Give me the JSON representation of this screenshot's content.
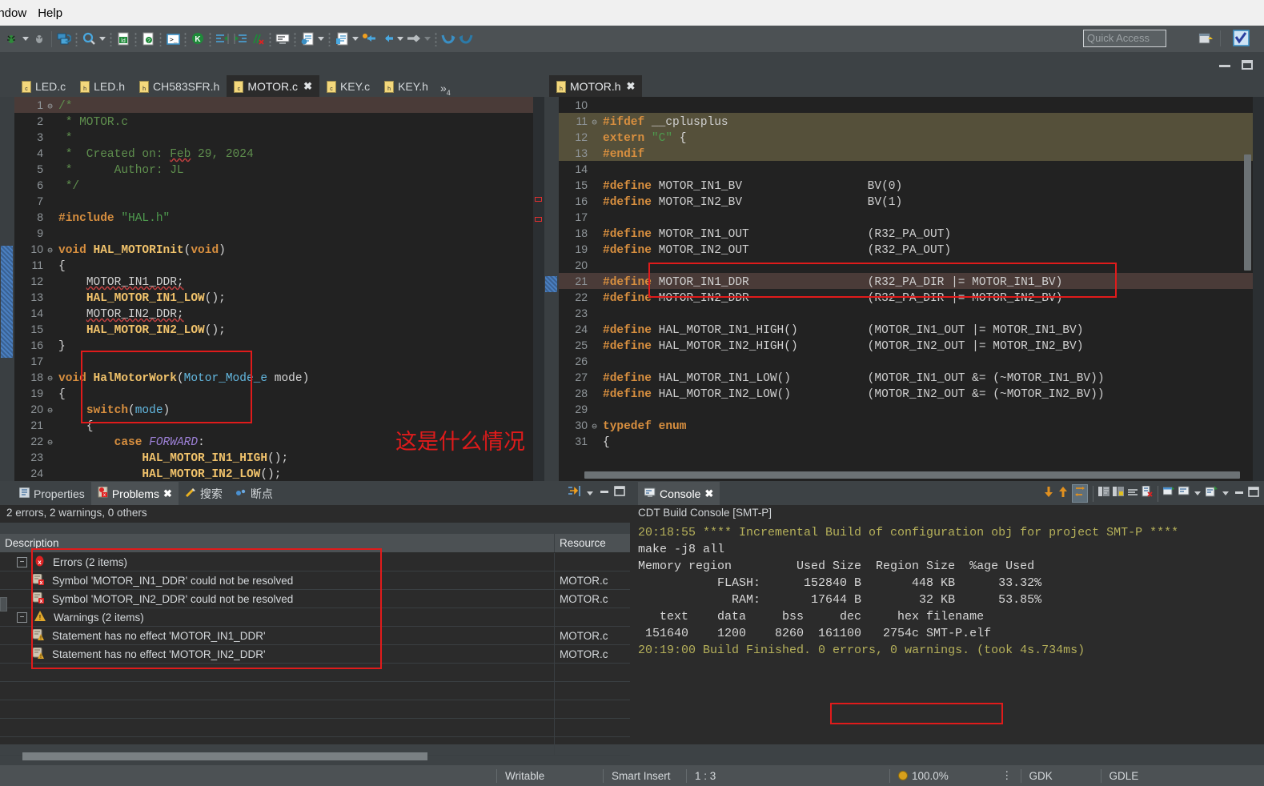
{
  "menubar": {
    "items": [
      "indow",
      "Help"
    ]
  },
  "toolbar": {
    "quick_access_placeholder": "Quick Access",
    "icons": [
      "bug-run-icon",
      "bug-run-dropdown",
      "debug-icon",
      "build-all-icon",
      "search-icon",
      "search-dropdown",
      "new-c-file-icon",
      "new-header-icon",
      "terminal-icon",
      "kconfig-icon",
      "indent-right-icon",
      "indent-left-icon",
      "comment-strike-icon",
      "console-icon",
      "open-type-icon",
      "open-type-dropdown",
      "open-resource-icon",
      "open-resource-dropdown",
      "back-annotate-icon",
      "back-arrow-icon",
      "back-dropdown",
      "forward-arrow-icon",
      "forward-dropdown",
      "undo-nav-icon",
      "redo-nav-icon"
    ],
    "right_icons": [
      "perspective-add-icon",
      "perspective-cpp-icon"
    ],
    "window_minimize": "minimize",
    "window_maximize": "maximize"
  },
  "editor_left": {
    "tabs": [
      {
        "label": "LED.c",
        "kind": "c",
        "active": false,
        "closable": false
      },
      {
        "label": "LED.h",
        "kind": "h",
        "active": false,
        "closable": false
      },
      {
        "label": "CH583SFR.h",
        "kind": "h",
        "active": false,
        "closable": false
      },
      {
        "label": "MOTOR.c",
        "kind": "c",
        "active": true,
        "closable": true
      },
      {
        "label": "KEY.c",
        "kind": "c",
        "active": false,
        "closable": false
      },
      {
        "label": "KEY.h",
        "kind": "h",
        "active": false,
        "closable": false
      }
    ],
    "overflow_label": "»",
    "overflow_count": "4",
    "lines": [
      {
        "n": "1",
        "fold": "⊖",
        "hl": "brown",
        "tokens": [
          {
            "t": "/*",
            "c": "cmt"
          }
        ]
      },
      {
        "n": "2",
        "fold": "",
        "tokens": [
          {
            "t": " * MOTOR.c",
            "c": "cmt"
          }
        ]
      },
      {
        "n": "3",
        "fold": "",
        "tokens": [
          {
            "t": " *",
            "c": "cmt"
          }
        ]
      },
      {
        "n": "4",
        "fold": "",
        "tokens": [
          {
            "t": " *  Created on: ",
            "c": "cmt"
          },
          {
            "t": "Feb",
            "c": "cmt",
            "squiggle": true
          },
          {
            "t": " 29, 2024",
            "c": "cmt"
          }
        ]
      },
      {
        "n": "5",
        "fold": "",
        "tokens": [
          {
            "t": " *      Author: JL",
            "c": "cmt"
          }
        ]
      },
      {
        "n": "6",
        "fold": "",
        "tokens": [
          {
            "t": " */",
            "c": "cmt"
          }
        ]
      },
      {
        "n": "7",
        "fold": "",
        "tokens": []
      },
      {
        "n": "8",
        "fold": "",
        "tokens": [
          {
            "t": "#include",
            "c": "pp"
          },
          {
            "t": " ",
            "c": "txt"
          },
          {
            "t": "\"HAL.h\"",
            "c": "str"
          }
        ]
      },
      {
        "n": "9",
        "fold": "",
        "tokens": []
      },
      {
        "n": "10",
        "fold": "⊖",
        "sel": true,
        "tokens": [
          {
            "t": "void",
            "c": "kw"
          },
          {
            "t": " ",
            "c": "txt"
          },
          {
            "t": "HAL_MOTORInit",
            "c": "fn"
          },
          {
            "t": "(",
            "c": "txt"
          },
          {
            "t": "void",
            "c": "kw"
          },
          {
            "t": ")",
            "c": "txt"
          }
        ]
      },
      {
        "n": "11",
        "fold": "",
        "sel": true,
        "tokens": [
          {
            "t": "{",
            "c": "txt"
          }
        ]
      },
      {
        "n": "12",
        "fold": "",
        "sel": true,
        "bp": "error",
        "tokens": [
          {
            "t": "    ",
            "c": "txt"
          },
          {
            "t": "MOTOR_IN1_DDR;",
            "c": "pln",
            "squiggle": true
          }
        ]
      },
      {
        "n": "13",
        "fold": "",
        "sel": true,
        "tokens": [
          {
            "t": "    ",
            "c": "txt"
          },
          {
            "t": "HAL_MOTOR_IN1_LOW",
            "c": "fn"
          },
          {
            "t": "();",
            "c": "txt"
          }
        ]
      },
      {
        "n": "14",
        "fold": "",
        "sel": true,
        "bp": "error",
        "tokens": [
          {
            "t": "    ",
            "c": "txt"
          },
          {
            "t": "MOTOR_IN2_DDR;",
            "c": "pln",
            "squiggle": true
          }
        ]
      },
      {
        "n": "15",
        "fold": "",
        "sel": true,
        "tokens": [
          {
            "t": "    ",
            "c": "txt"
          },
          {
            "t": "HAL_MOTOR_IN2_LOW",
            "c": "fn"
          },
          {
            "t": "();",
            "c": "txt"
          }
        ]
      },
      {
        "n": "16",
        "fold": "",
        "sel": true,
        "tokens": [
          {
            "t": "}",
            "c": "txt"
          }
        ]
      },
      {
        "n": "17",
        "fold": "",
        "tokens": []
      },
      {
        "n": "18",
        "fold": "⊖",
        "tokens": [
          {
            "t": "void",
            "c": "kw"
          },
          {
            "t": " ",
            "c": "txt"
          },
          {
            "t": "HalMotorWork",
            "c": "fn"
          },
          {
            "t": "(",
            "c": "txt"
          },
          {
            "t": "Motor_Mode_e",
            "c": "ty"
          },
          {
            "t": " mode)",
            "c": "txt"
          }
        ]
      },
      {
        "n": "19",
        "fold": "",
        "tokens": [
          {
            "t": "{",
            "c": "txt"
          }
        ]
      },
      {
        "n": "20",
        "fold": "⊖",
        "tokens": [
          {
            "t": "    ",
            "c": "txt"
          },
          {
            "t": "switch",
            "c": "kw"
          },
          {
            "t": "(",
            "c": "txt"
          },
          {
            "t": "mode",
            "c": "ty"
          },
          {
            "t": ")",
            "c": "txt"
          }
        ]
      },
      {
        "n": "21",
        "fold": "",
        "tokens": [
          {
            "t": "    {",
            "c": "txt"
          }
        ]
      },
      {
        "n": "22",
        "fold": "⊖",
        "tokens": [
          {
            "t": "        ",
            "c": "txt"
          },
          {
            "t": "case",
            "c": "kw"
          },
          {
            "t": " ",
            "c": "txt"
          },
          {
            "t": "FORWARD",
            "c": "en"
          },
          {
            "t": ":",
            "c": "txt"
          }
        ]
      },
      {
        "n": "23",
        "fold": "",
        "tokens": [
          {
            "t": "            ",
            "c": "txt"
          },
          {
            "t": "HAL_MOTOR_IN1_HIGH",
            "c": "fn"
          },
          {
            "t": "();",
            "c": "txt"
          }
        ]
      },
      {
        "n": "24",
        "fold": "",
        "tokens": [
          {
            "t": "            ",
            "c": "txt"
          },
          {
            "t": "HAL_MOTOR_IN2_LOW",
            "c": "fn"
          },
          {
            "t": "();",
            "c": "txt"
          }
        ]
      }
    ],
    "annotation": "这是什么情况"
  },
  "editor_right": {
    "tabs": [
      {
        "label": "MOTOR.h",
        "kind": "h",
        "active": true,
        "closable": true
      }
    ],
    "lines": [
      {
        "n": "10",
        "fold": "",
        "tokens": []
      },
      {
        "n": "11",
        "fold": "⊖",
        "hl": "olive",
        "tokens": [
          {
            "t": "#ifdef",
            "c": "pp"
          },
          {
            "t": " __cplusplus",
            "c": "pln"
          }
        ]
      },
      {
        "n": "12",
        "fold": "",
        "hl": "olive",
        "tokens": [
          {
            "t": "extern",
            "c": "kw"
          },
          {
            "t": " ",
            "c": "txt"
          },
          {
            "t": "\"C\"",
            "c": "str"
          },
          {
            "t": " {",
            "c": "txt"
          }
        ]
      },
      {
        "n": "13",
        "fold": "",
        "hl": "olive",
        "tokens": [
          {
            "t": "#endif",
            "c": "pp"
          }
        ]
      },
      {
        "n": "14",
        "fold": "",
        "tokens": []
      },
      {
        "n": "15",
        "fold": "",
        "tokens": [
          {
            "t": "#define",
            "c": "pp"
          },
          {
            "t": " MOTOR_IN1_BV                  BV(0)",
            "c": "pln"
          }
        ]
      },
      {
        "n": "16",
        "fold": "",
        "tokens": [
          {
            "t": "#define",
            "c": "pp"
          },
          {
            "t": " MOTOR_IN2_BV                  BV(1)",
            "c": "pln"
          }
        ]
      },
      {
        "n": "17",
        "fold": "",
        "tokens": []
      },
      {
        "n": "18",
        "fold": "",
        "tokens": [
          {
            "t": "#define",
            "c": "pp"
          },
          {
            "t": " MOTOR_IN1_OUT                 (R32_PA_OUT)",
            "c": "pln"
          }
        ]
      },
      {
        "n": "19",
        "fold": "",
        "tokens": [
          {
            "t": "#define",
            "c": "pp"
          },
          {
            "t": " MOTOR_IN2_OUT                 (R32_PA_OUT)",
            "c": "pln"
          }
        ]
      },
      {
        "n": "20",
        "fold": "",
        "tokens": []
      },
      {
        "n": "21",
        "fold": "",
        "hl": "brown",
        "sel": true,
        "tokens": [
          {
            "t": "#define",
            "c": "pp"
          },
          {
            "t": " MOTOR_IN1_DDR                 (R32_PA_DIR |= MOTOR_IN1_BV)",
            "c": "pln"
          }
        ]
      },
      {
        "n": "22",
        "fold": "",
        "tokens": [
          {
            "t": "#define",
            "c": "pp"
          },
          {
            "t": " MOTOR_IN2_DDR                 (R32_PA_DIR |= MOTOR_IN2_BV)",
            "c": "pln"
          }
        ]
      },
      {
        "n": "23",
        "fold": "",
        "tokens": []
      },
      {
        "n": "24",
        "fold": "",
        "tokens": [
          {
            "t": "#define",
            "c": "pp"
          },
          {
            "t": " HAL_MOTOR_IN1_HIGH()          (MOTOR_IN1_OUT |= MOTOR_IN1_BV)",
            "c": "pln"
          }
        ]
      },
      {
        "n": "25",
        "fold": "",
        "tokens": [
          {
            "t": "#define",
            "c": "pp"
          },
          {
            "t": " HAL_MOTOR_IN2_HIGH()          (MOTOR_IN2_OUT |= MOTOR_IN2_BV)",
            "c": "pln"
          }
        ]
      },
      {
        "n": "26",
        "fold": "",
        "tokens": []
      },
      {
        "n": "27",
        "fold": "",
        "tokens": [
          {
            "t": "#define",
            "c": "pp"
          },
          {
            "t": " HAL_MOTOR_IN1_LOW()           (MOTOR_IN1_OUT &= (~MOTOR_IN1_BV))",
            "c": "pln"
          }
        ]
      },
      {
        "n": "28",
        "fold": "",
        "tokens": [
          {
            "t": "#define",
            "c": "pp"
          },
          {
            "t": " HAL_MOTOR_IN2_LOW()           (MOTOR_IN2_OUT &= (~MOTOR_IN2_BV))",
            "c": "pln"
          }
        ]
      },
      {
        "n": "29",
        "fold": "",
        "tokens": []
      },
      {
        "n": "30",
        "fold": "⊖",
        "tokens": [
          {
            "t": "typedef",
            "c": "kw"
          },
          {
            "t": " ",
            "c": "txt"
          },
          {
            "t": "enum",
            "c": "kw"
          }
        ]
      },
      {
        "n": "31",
        "fold": "",
        "tokens": [
          {
            "t": "{",
            "c": "txt"
          }
        ]
      }
    ]
  },
  "problems_panel": {
    "tabs": [
      {
        "label": "Properties",
        "icon": "properties-icon",
        "active": false,
        "closable": false
      },
      {
        "label": "Problems",
        "icon": "problems-icon",
        "active": true,
        "closable": true
      },
      {
        "label": "搜索",
        "icon": "search-view-icon",
        "active": false,
        "closable": false
      },
      {
        "label": "断点",
        "icon": "breakpoints-icon",
        "active": false,
        "closable": false
      }
    ],
    "summary": "2 errors, 2 warnings, 0 others",
    "columns": [
      "Description",
      "Resource"
    ],
    "rows": [
      {
        "level": 0,
        "twisty": "⊟",
        "icon": "error-group-icon",
        "desc": "Errors (2 items)",
        "resource": ""
      },
      {
        "level": 1,
        "twisty": "",
        "icon": "error-item-icon",
        "desc": "Symbol 'MOTOR_IN1_DDR' could not be resolved",
        "resource": "MOTOR.c"
      },
      {
        "level": 1,
        "twisty": "",
        "icon": "error-item-icon",
        "desc": "Symbol 'MOTOR_IN2_DDR' could not be resolved",
        "resource": "MOTOR.c"
      },
      {
        "level": 0,
        "twisty": "⊟",
        "icon": "warning-group-icon",
        "desc": "Warnings (2 items)",
        "resource": ""
      },
      {
        "level": 1,
        "twisty": "",
        "icon": "warning-item-icon",
        "desc": "Statement has no effect 'MOTOR_IN1_DDR'",
        "resource": "MOTOR.c"
      },
      {
        "level": 1,
        "twisty": "",
        "icon": "warning-item-icon",
        "desc": "Statement has no effect 'MOTOR_IN2_DDR'",
        "resource": "MOTOR.c"
      }
    ]
  },
  "console_panel": {
    "tab_label": "Console",
    "title": "CDT Build Console [SMT-P]",
    "lines": [
      {
        "text": "20:18:55 **** Incremental Build of configuration obj for project SMT-P ****",
        "style": "olive"
      },
      {
        "text": "make -j8 all",
        "style": "normal"
      },
      {
        "text": "Memory region         Used Size  Region Size  %age Used",
        "style": "normal"
      },
      {
        "text": "           FLASH:      152840 B       448 KB      33.32%",
        "style": "normal"
      },
      {
        "text": "             RAM:       17644 B        32 KB      53.85%",
        "style": "normal"
      },
      {
        "text": "   text    data     bss     dec     hex filename",
        "style": "normal"
      },
      {
        "text": " 151640    1200    8260  161100   2754c SMT-P.elf",
        "style": "normal"
      },
      {
        "text": "",
        "style": "normal"
      },
      {
        "text": "20:19:00 Build Finished. 0 errors, 0 warnings. (took 4s.734ms)",
        "style": "olive"
      }
    ],
    "highlight_text": "0 errors, 0 warnings."
  },
  "status_bar": {
    "writable": "Writable",
    "insert_mode": "Smart Insert",
    "position": "1 : 3",
    "zoom": "100.0%",
    "right_items": [
      "GDK",
      "GDLE"
    ]
  },
  "colors": {
    "editor_bg": "#222222",
    "chrome_bg": "#3d4245",
    "toolbar_bg": "#4c5154",
    "accent_red": "#e01b1b",
    "olive_highlight": "#55503a",
    "brown_highlight": "#433b3a",
    "console_olive": "#b5b05a"
  }
}
